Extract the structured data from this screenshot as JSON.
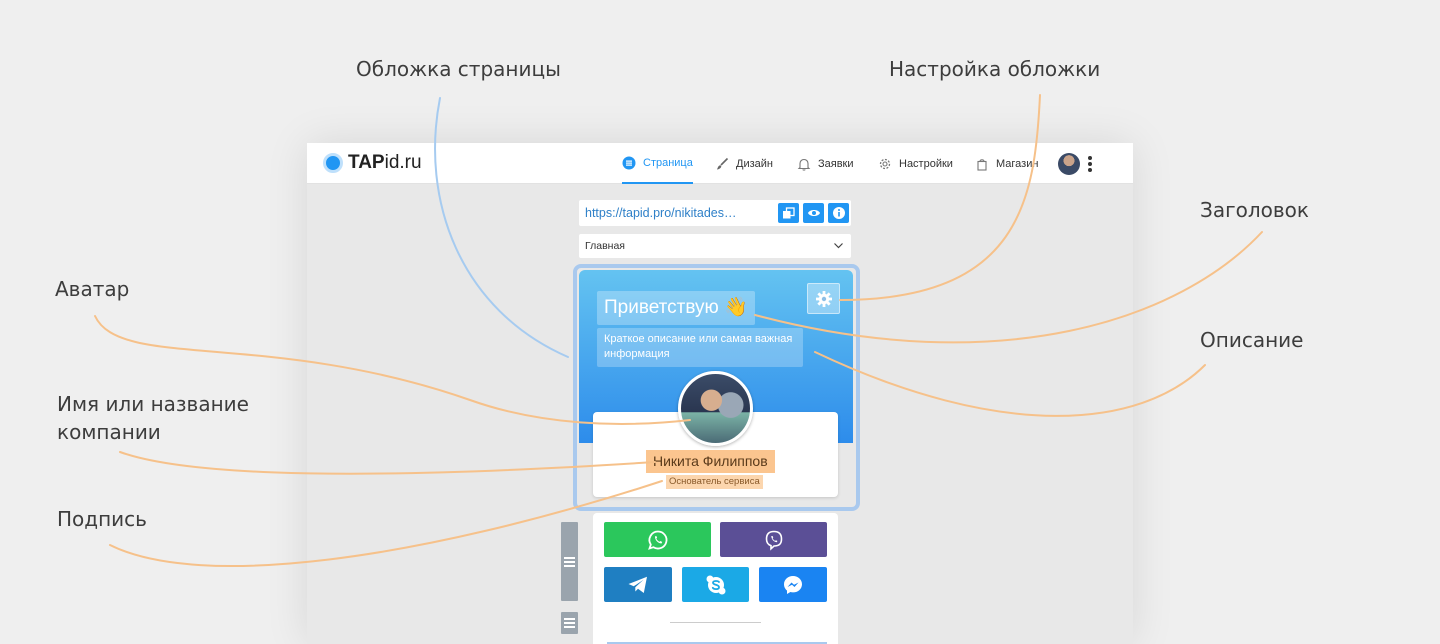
{
  "callouts": {
    "cover": "Обложка страницы",
    "cover_settings": "Настройка обложки",
    "title": "Заголовок",
    "avatar": "Аватар",
    "description": "Описание",
    "name_line1": "Имя или название",
    "name_line2": "компании",
    "signature": "Подпись"
  },
  "app": {
    "logo_bold": "TAP",
    "logo_rest": "id.ru",
    "nav": [
      {
        "label": "Страница",
        "icon": "list-circle-icon",
        "active": true
      },
      {
        "label": "Дизайн",
        "icon": "brush-icon"
      },
      {
        "label": "Заявки",
        "icon": "bell-icon"
      },
      {
        "label": "Настройки",
        "icon": "gear-icon"
      },
      {
        "label": "Магазин",
        "icon": "shopping-bag-icon"
      }
    ],
    "url": "https://tapid.pro/nikitades…",
    "page_select": "Главная",
    "cover_title": "Приветствую 👋",
    "cover_description": "Краткое описание или самая важная информация",
    "profile_name": "Никита Филиппов",
    "profile_subtitle": "Основатель сервиса",
    "messengers": [
      "WhatsApp",
      "Viber",
      "Telegram",
      "Skype",
      "Messenger"
    ]
  },
  "colors": {
    "accent": "#2196f3",
    "callout_line_orange": "#f6c18a",
    "callout_line_blue": "#a6cbf0",
    "whatsapp": "#2bc75c",
    "viber": "#5b4f96",
    "telegram": "#1f7fc2",
    "skype": "#1ba9e6",
    "messenger": "#1a84f2"
  }
}
